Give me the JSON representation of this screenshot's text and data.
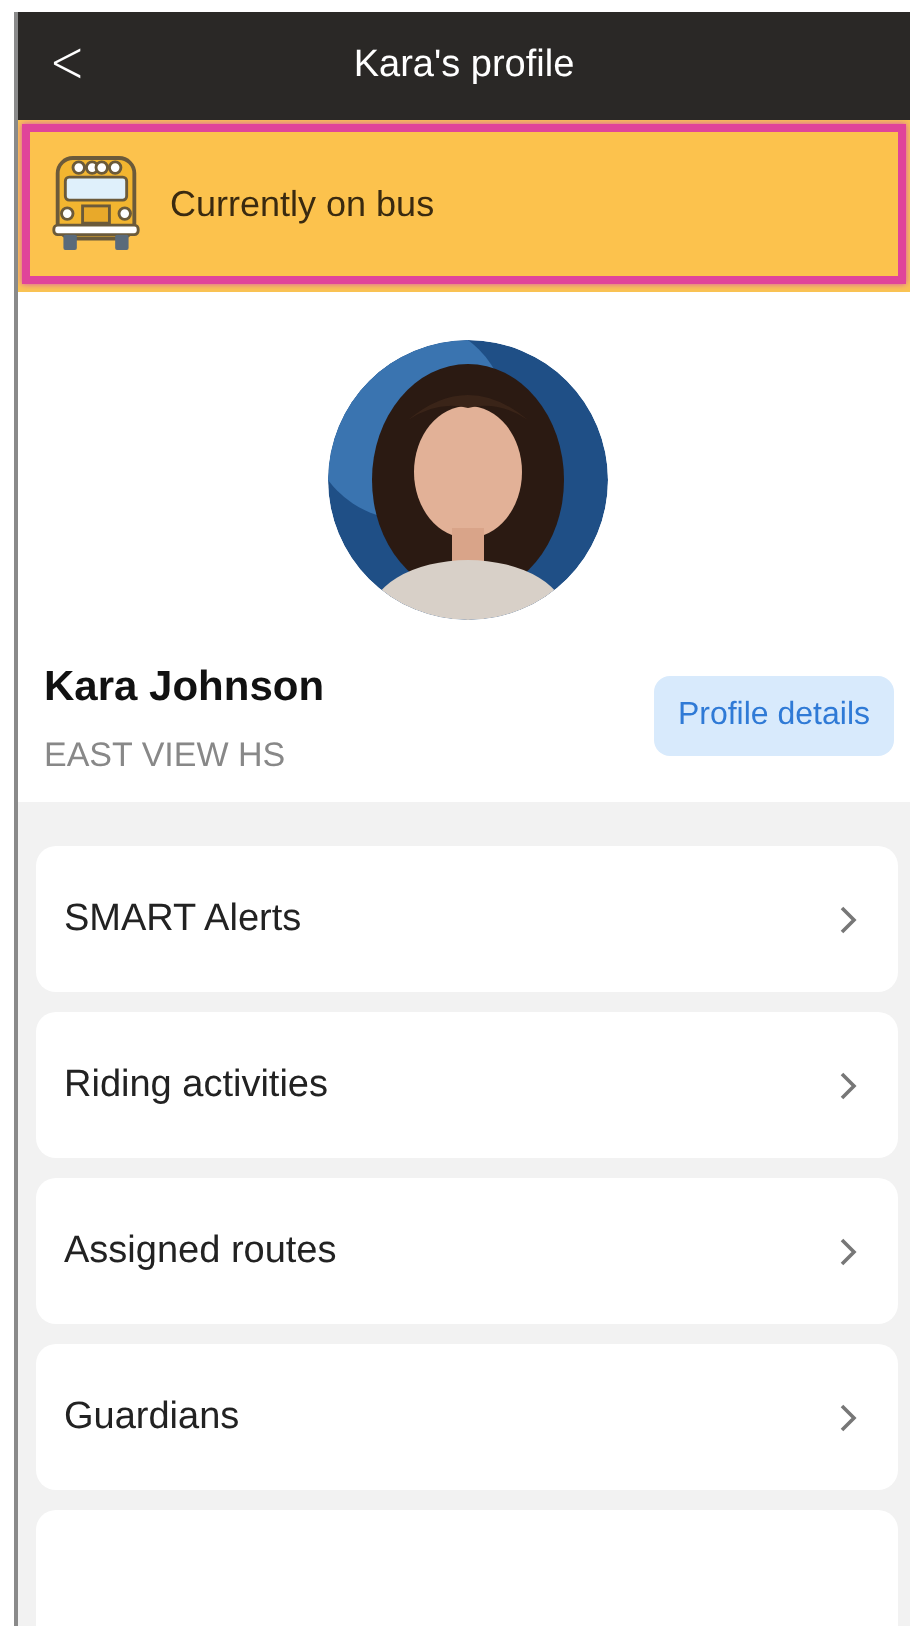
{
  "header": {
    "title": "Kara's profile",
    "back": "<"
  },
  "status_banner": {
    "text": "Currently on bus"
  },
  "profile": {
    "name": "Kara Johnson",
    "school": "EAST VIEW HS",
    "details_button": "Profile details"
  },
  "menu_items": [
    {
      "kind": "link",
      "label": "SMART Alerts"
    },
    {
      "kind": "link",
      "label": "Riding activities"
    },
    {
      "kind": "link",
      "label": "Assigned routes"
    },
    {
      "kind": "link",
      "label": "Guardians"
    },
    {
      "kind": "partial"
    }
  ]
}
